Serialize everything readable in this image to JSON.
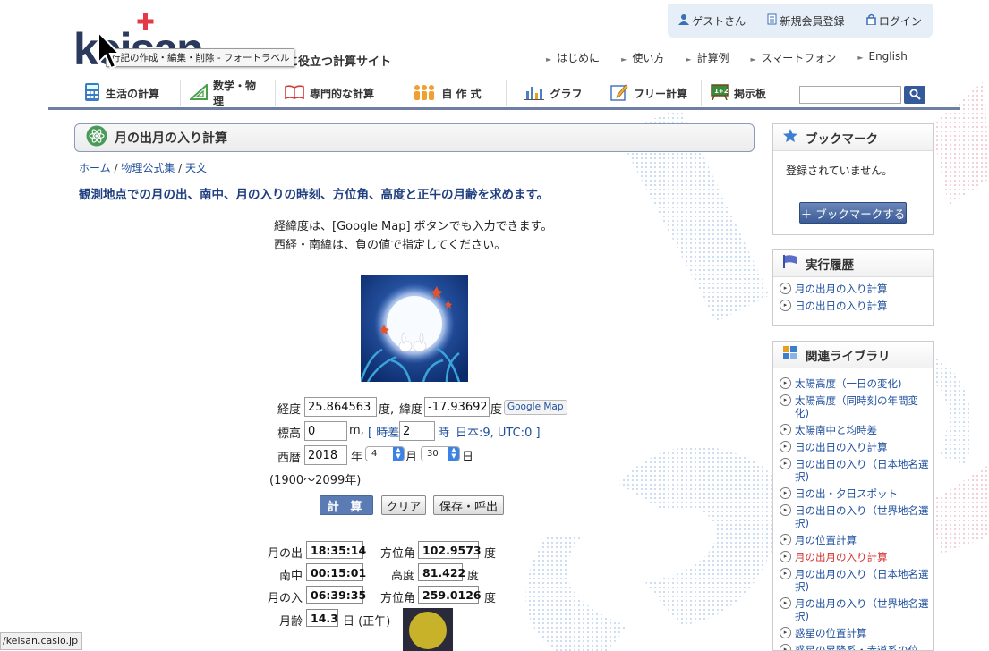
{
  "userbar": {
    "guest": "ゲストさん",
    "register": "新規会員登録",
    "login": "ログイン"
  },
  "logo": {
    "text": "keisan"
  },
  "tagline": "に役立つ計算サイト",
  "tooltip": "行記の作成・編集・削除 - フォートラベル",
  "topnav": [
    {
      "label": "はじめに"
    },
    {
      "label": "使い方"
    },
    {
      "label": "計算例"
    },
    {
      "label": "スマートフォン"
    },
    {
      "label": "English"
    }
  ],
  "mainnav": [
    {
      "label": "生活の計算",
      "icon": "calculator-icon"
    },
    {
      "label": "数学・物理",
      "icon": "triangle-ruler-icon"
    },
    {
      "label": "専門的な計算",
      "icon": "book-icon"
    },
    {
      "label": "自 作 式",
      "icon": "people-icon"
    },
    {
      "label": "グラフ",
      "icon": "bar-chart-icon"
    },
    {
      "label": "フリー計算",
      "icon": "pencil-note-icon"
    },
    {
      "label": "掲示板",
      "icon": "board-icon"
    }
  ],
  "page": {
    "title": "月の出月の入り計算",
    "breadcrumb": [
      "ホーム",
      "物理公式集",
      "天文"
    ],
    "headline": "観測地点での月の出、南中、月の入りの時刻、方位角、高度と正午の月齢を求めます。",
    "info1": "経緯度は、[Google Map] ボタンでも入力できます。",
    "info2": "西経・南緯は、負の値で指定してください。"
  },
  "form": {
    "lon_label": "経度",
    "lon_value": "25.864563",
    "deg1": "度,",
    "lat_label": "緯度",
    "lat_value": "-17.93692",
    "deg2": "度",
    "gmap": "Google Map",
    "alt_label": "標高",
    "alt_value": "0",
    "alt_unit": "m,",
    "tz_label": "[ 時差",
    "tz_value": "2",
    "tz_unit": "時",
    "tz_hint": "日本:9, UTC:0 ]",
    "year_label": "西暦",
    "year_value": "2018",
    "year_unit": "年",
    "month_value": "4",
    "month_unit": "月",
    "day_value": "30",
    "day_unit": "日",
    "range": "(1900〜2099年)",
    "calc": "計 算",
    "clear": "クリア",
    "save": "保存・呼出"
  },
  "results": {
    "rise_label": "月の出",
    "rise_time": "18:35:14",
    "rise_az_label": "方位角",
    "rise_az": "102.9573",
    "deg": "度",
    "transit_label": "南中",
    "transit_time": "00:15:01",
    "transit_alt_label": "高度",
    "transit_alt": "81.422",
    "set_label": "月の入",
    "set_time": "06:39:35",
    "set_az_label": "方位角",
    "set_az": "259.0126",
    "age_label": "月齢",
    "age_value": "14.3",
    "age_unit": "日 (正午)"
  },
  "sidebar": {
    "bookmark_title": "ブックマーク",
    "bookmark_empty": "登録されていません。",
    "bookmark_button": "＋ ブックマークする",
    "history_title": "実行履歴",
    "history": [
      "月の出月の入り計算",
      "日の出日の入り計算"
    ],
    "related_title": "関連ライブラリ",
    "related": [
      "太陽高度（一日の変化)",
      "太陽高度（同時刻の年間変化)",
      "太陽南中と均時差",
      "日の出日の入り計算",
      "日の出日の入り（日本地名選択)",
      "日の出・夕日スポット",
      "日の出日の入り（世界地名選択)",
      "月の位置計算",
      "月の出月の入り計算",
      "月の出月の入り（日本地名選択)",
      "月の出月の入り（世界地名選択)",
      "惑星の位置計算",
      "惑星の昇降系・赤道系の位"
    ],
    "current_index": 8
  },
  "statusbar": "/keisan.casio.jp",
  "colors": {
    "accent": "#1f3f80",
    "nav_line": "#6f7fa3",
    "current": "#d43333"
  }
}
